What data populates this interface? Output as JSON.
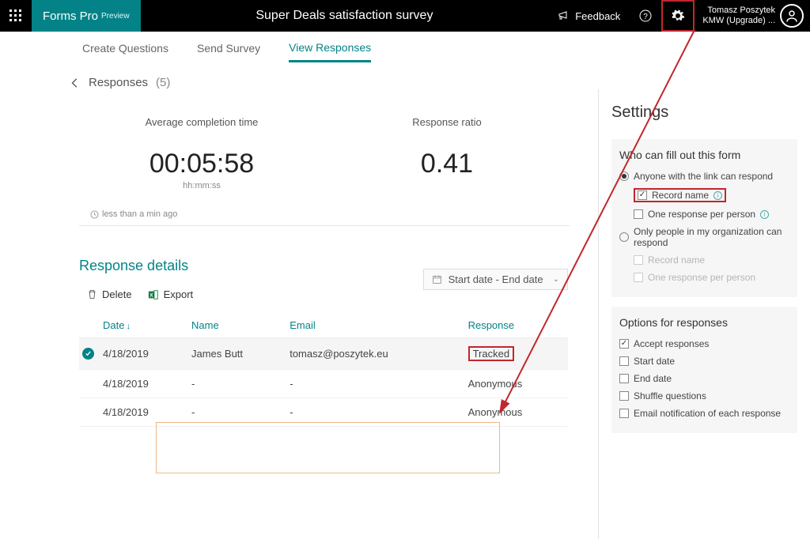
{
  "header": {
    "brand": "Forms Pro",
    "brand_suffix": "Preview",
    "title": "Super Deals satisfaction survey",
    "feedback": "Feedback",
    "user_name": "Tomasz Poszytek",
    "user_org": "KMW (Upgrade) ..."
  },
  "tabs": {
    "create": "Create Questions",
    "send": "Send Survey",
    "view": "View Responses"
  },
  "breadcrumb": {
    "label": "Responses",
    "count": "(5)"
  },
  "stats": {
    "avg_label": "Average completion time",
    "avg_value": "00:05:58",
    "avg_sub": "hh:mm:ss",
    "ratio_label": "Response ratio",
    "ratio_value": "0.41",
    "updated": "less than a min ago"
  },
  "details": {
    "title": "Response details",
    "delete": "Delete",
    "export": "Export",
    "date_pill": "Start date - End date",
    "cols": {
      "date": "Date",
      "name": "Name",
      "email": "Email",
      "response": "Response"
    },
    "rows": [
      {
        "date": "4/18/2019",
        "name": "James Butt",
        "email": "tomasz@poszytek.eu",
        "response": "Tracked",
        "selected": true
      },
      {
        "date": "4/18/2019",
        "name": "-",
        "email": "-",
        "response": "Anonymous",
        "selected": false
      },
      {
        "date": "4/18/2019",
        "name": "-",
        "email": "-",
        "response": "Anonymous",
        "selected": false
      }
    ]
  },
  "settings": {
    "title": "Settings",
    "who_title": "Who can fill out this form",
    "anyone": "Anyone with the link can respond",
    "record": "Record name",
    "one_per": "One response per person",
    "org": "Only people in my organization can respond",
    "record2": "Record name",
    "one_per2": "One response per person",
    "opts_title": "Options for responses",
    "accept": "Accept responses",
    "start": "Start date",
    "end": "End date",
    "shuffle": "Shuffle questions",
    "email_notif": "Email notification of each response"
  }
}
